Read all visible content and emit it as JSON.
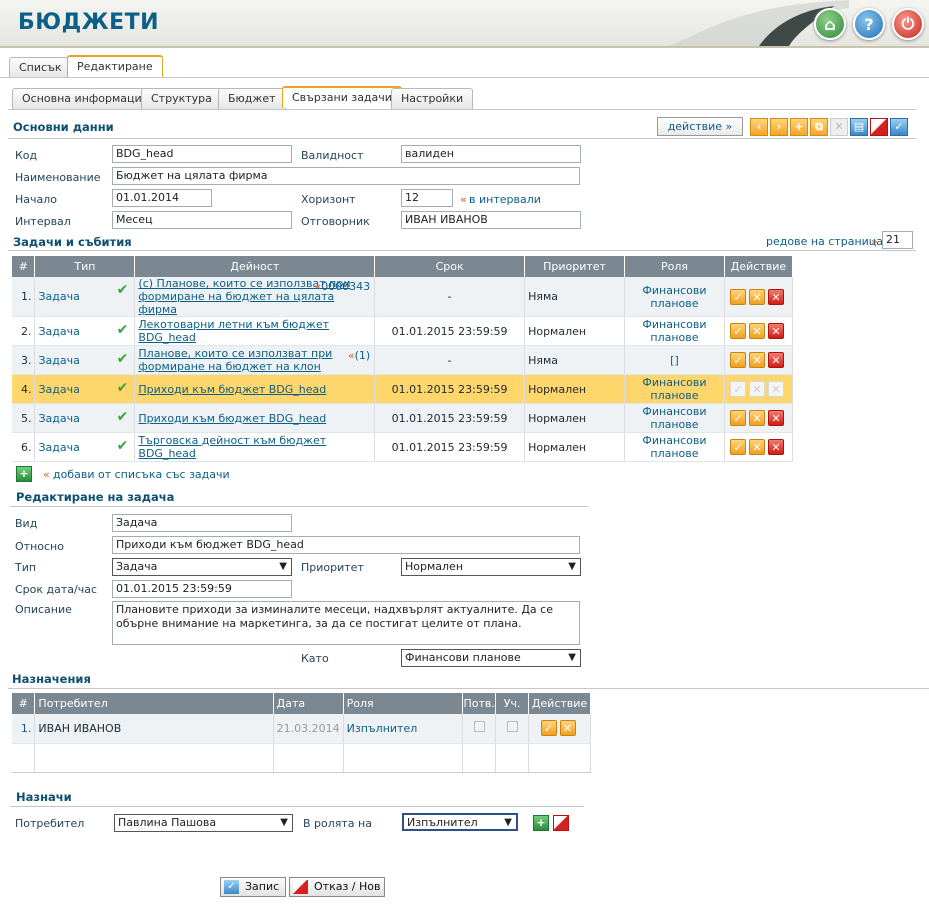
{
  "app": {
    "title": "БЮДЖЕТИ"
  },
  "main_tabs": [
    "Списък",
    "Редактиране"
  ],
  "sub_tabs": [
    "Основна информация",
    "Структура",
    "Бюджет",
    "Свързани задачи",
    "Настройки"
  ],
  "basic": {
    "title": "Основни данни",
    "action_label": "действие »",
    "code_label": "Код",
    "code": "BDG_head",
    "validity_label": "Валидност",
    "validity": "валиден",
    "name_label": "Наименование",
    "name": "Бюджет на цялата фирма",
    "start_label": "Начало",
    "start": "01.01.2014",
    "horizon_label": "Хоризонт",
    "horizon": "12",
    "horizon_unit": "в интервали",
    "interval_label": "Интервал",
    "interval": "Месец",
    "owner_label": "Отговорник",
    "owner": "ИВАН ИВАНОВ"
  },
  "tasks": {
    "title": "Задачи и събития",
    "rows_per_page_label": "редове на страница",
    "rows_per_page": "21",
    "columns": [
      "#",
      "Тип",
      "Дейност",
      "Срок",
      "Приоритет",
      "Роля",
      "Действие"
    ],
    "rows": [
      {
        "n": "1.",
        "type": "Задача",
        "activity": "(с) Планове, които се използват при формиране на бюджет на цялата фирма",
        "ref": "0000343",
        "deadline": "-",
        "priority": "Няма",
        "role": "Финансови планове"
      },
      {
        "n": "2.",
        "type": "Задача",
        "activity": "Лекотоварни летни към бюджет BDG_head",
        "ref": "",
        "deadline": "01.01.2015 23:59:59",
        "priority": "Нормален",
        "role": "Финансови планове"
      },
      {
        "n": "3.",
        "type": "Задача",
        "activity": "Планове, които се използват при формиране на бюджет на клон",
        "ref": "(1)",
        "deadline": "-",
        "priority": "Няма",
        "role": "[]"
      },
      {
        "n": "4.",
        "type": "Задача",
        "activity": "Приходи към бюджет BDG_head",
        "ref": "",
        "deadline": "01.01.2015 23:59:59",
        "priority": "Нормален",
        "role": "Финансови планове"
      },
      {
        "n": "5.",
        "type": "Задача",
        "activity": "Приходи към бюджет BDG_head",
        "ref": "",
        "deadline": "01.01.2015 23:59:59",
        "priority": "Нормален",
        "role": "Финансови планове"
      },
      {
        "n": "6.",
        "type": "Задача",
        "activity": "Търговска дейност към бюджет BDG_head",
        "ref": "",
        "deadline": "01.01.2015 23:59:59",
        "priority": "Нормален",
        "role": "Финансови планове"
      }
    ],
    "add_label": "добави от списъка със задачи"
  },
  "edit": {
    "title": "Редактиране на задача",
    "kind_label": "Вид",
    "kind": "Задача",
    "about_label": "Относно",
    "about": "Приходи към бюджет BDG_head",
    "type_label": "Тип",
    "type": "Задача",
    "priority_label": "Приоритет",
    "priority": "Нормален",
    "deadline_label": "Срок дата/час",
    "deadline": "01.01.2015 23:59:59",
    "desc_label": "Описание",
    "desc": "Плановите приходи за изминалите месеци, надхвърлят актуалните. Да се обърне внимание на маркетинга, за да се постигат целите от плана.",
    "as_label": "Като",
    "as": "Финансови планове"
  },
  "assign": {
    "title": "Назначения",
    "columns": [
      "#",
      "Потребител",
      "Дата",
      "Роля",
      "Потв.",
      "Уч.",
      "Действие"
    ],
    "rows": [
      {
        "n": "1.",
        "user": "ИВАН ИВАНОВ",
        "date": "21.03.2014",
        "role": "Изпълнител"
      }
    ]
  },
  "assign_new": {
    "title": "Назначи",
    "user_label": "Потребител",
    "user": "Павлина Пашова",
    "role_label": "В ролята на",
    "role": "Изпълнител"
  },
  "buttons": {
    "save": "Запис",
    "cancel": "Отказ / Нов"
  }
}
